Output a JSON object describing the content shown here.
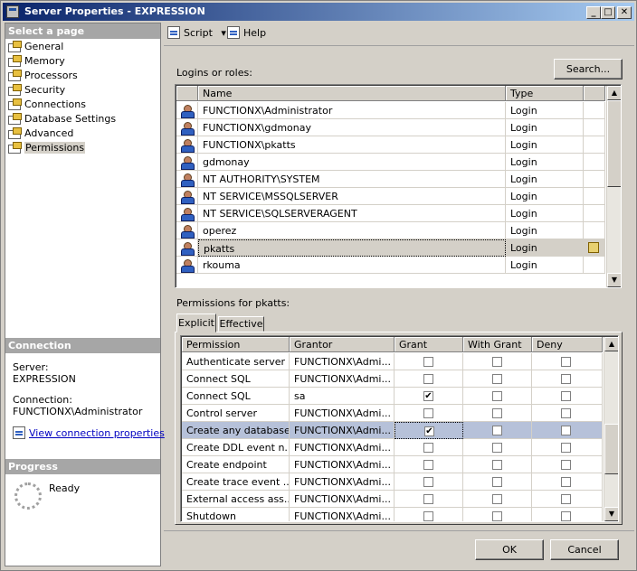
{
  "window": {
    "title": "Server Properties - EXPRESSION"
  },
  "title_buttons": {
    "minimize": "_",
    "maximize": "□",
    "close": "✕"
  },
  "left_pane": {
    "select_page_header": "Select a page",
    "pages": [
      "General",
      "Memory",
      "Processors",
      "Security",
      "Connections",
      "Database Settings",
      "Advanced",
      "Permissions"
    ],
    "connection_header": "Connection",
    "server_label": "Server:",
    "server_value": "EXPRESSION",
    "connection_label": "Connection:",
    "connection_value": "FUNCTIONX\\Administrator",
    "view_conn_props": "View connection properties",
    "progress_header": "Progress",
    "progress_status": "Ready"
  },
  "toolbar": {
    "script_label": "Script",
    "script_dropdown": "▾",
    "help_label": "Help"
  },
  "logins": {
    "label": "Logins or roles:",
    "search_label": "Search...",
    "columns": [
      "Name",
      "Type"
    ],
    "rows": [
      [
        "FUNCTIONX\\Administrator",
        "Login"
      ],
      [
        "FUNCTIONX\\gdmonay",
        "Login"
      ],
      [
        "FUNCTIONX\\pkatts",
        "Login"
      ],
      [
        "gdmonay",
        "Login"
      ],
      [
        "NT AUTHORITY\\SYSTEM",
        "Login"
      ],
      [
        "NT SERVICE\\MSSQLSERVER",
        "Login"
      ],
      [
        "NT SERVICE\\SQLSERVERAGENT",
        "Login"
      ],
      [
        "operez",
        "Login"
      ],
      [
        "pkatts",
        "Login"
      ],
      [
        "rkouma",
        "Login"
      ]
    ],
    "selected_index": 8
  },
  "permissions": {
    "label": "Permissions for pkatts:",
    "tabs": [
      "Explicit",
      "Effective"
    ],
    "active_tab": "Explicit",
    "columns": [
      "Permission",
      "Grantor",
      "Grant",
      "With Grant",
      "Deny"
    ],
    "rows": [
      {
        "permission": "Authenticate server",
        "grantor": "FUNCTIONX\\Admi...",
        "grant": false,
        "with_grant": false,
        "deny": false
      },
      {
        "permission": "Connect SQL",
        "grantor": "FUNCTIONX\\Admi...",
        "grant": false,
        "with_grant": false,
        "deny": false
      },
      {
        "permission": "Connect SQL",
        "grantor": "sa",
        "grant": true,
        "with_grant": false,
        "deny": false
      },
      {
        "permission": "Control server",
        "grantor": "FUNCTIONX\\Admi...",
        "grant": false,
        "with_grant": false,
        "deny": false
      },
      {
        "permission": "Create any database",
        "grantor": "FUNCTIONX\\Admi...",
        "grant": true,
        "with_grant": false,
        "deny": false
      },
      {
        "permission": "Create DDL event n...",
        "grantor": "FUNCTIONX\\Admi...",
        "grant": false,
        "with_grant": false,
        "deny": false
      },
      {
        "permission": "Create endpoint",
        "grantor": "FUNCTIONX\\Admi...",
        "grant": false,
        "with_grant": false,
        "deny": false
      },
      {
        "permission": "Create trace event ...",
        "grantor": "FUNCTIONX\\Admi...",
        "grant": false,
        "with_grant": false,
        "deny": false
      },
      {
        "permission": "External access ass...",
        "grantor": "FUNCTIONX\\Admi...",
        "grant": false,
        "with_grant": false,
        "deny": false
      },
      {
        "permission": "Shutdown",
        "grantor": "FUNCTIONX\\Admi...",
        "grant": false,
        "with_grant": false,
        "deny": false
      }
    ],
    "selected_index": 4,
    "check_glyph": "✔"
  },
  "scroll_arrows": {
    "up": "▲",
    "down": "▼"
  },
  "footer": {
    "ok_label": "OK",
    "cancel_label": "Cancel"
  }
}
